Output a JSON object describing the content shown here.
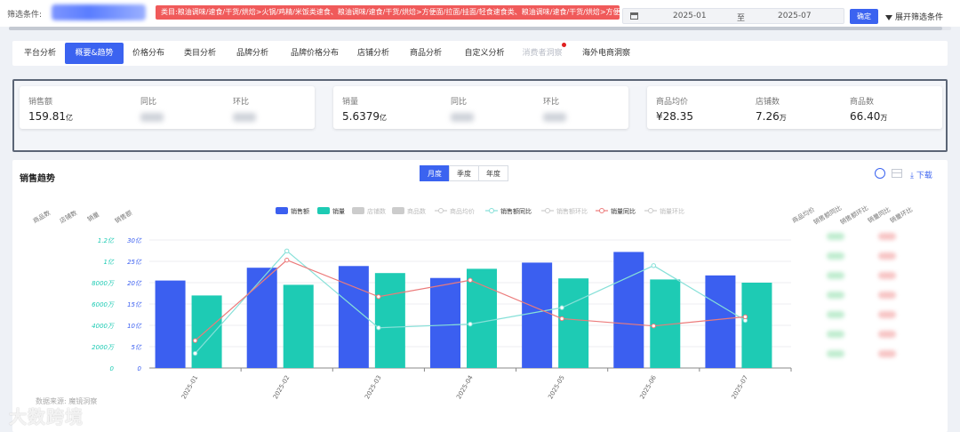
{
  "filter": {
    "label": "筛选条件:",
    "tags": "类目:粮油调味/速食/干货/烘焙>火锅/鸡精/米饭类速食、粮油调味/速食/干货/烘焙>方便面/拉面/挂面/轻食速食类、粮油调味/速食/干货/烘焙>方便粉丝/米线/粥汤类",
    "date_start": "2025-01",
    "date_sep": "至",
    "date_end": "2025-07",
    "confirm": "确定",
    "expand": "展开筛选条件"
  },
  "tabs": [
    {
      "label": "平台分析",
      "state": "normal"
    },
    {
      "label": "概要&趋势",
      "state": "active"
    },
    {
      "label": "价格分布",
      "state": "normal"
    },
    {
      "label": "类目分析",
      "state": "normal"
    },
    {
      "label": "品牌分析",
      "state": "normal"
    },
    {
      "label": "品牌价格分布",
      "state": "normal"
    },
    {
      "label": "店铺分析",
      "state": "normal"
    },
    {
      "label": "商品分析",
      "state": "normal"
    },
    {
      "label": "自定义分析",
      "state": "normal"
    },
    {
      "label": "消费者洞察",
      "state": "muted"
    },
    {
      "label": "海外电商洞察",
      "state": "normal"
    }
  ],
  "summary": {
    "sales": {
      "label": "销售额",
      "value": "159.81",
      "unit": "亿",
      "yoy": "同比",
      "mom": "环比"
    },
    "volume": {
      "label": "销量",
      "value": "5.6379",
      "unit": "亿",
      "yoy": "同比",
      "mom": "环比"
    },
    "avg_price": {
      "label": "商品均价",
      "value": "¥28.35"
    },
    "shops": {
      "label": "店铺数",
      "value": "7.26",
      "unit": "万"
    },
    "products": {
      "label": "商品数",
      "value": "66.40",
      "unit": "万"
    }
  },
  "panel": {
    "title": "销售趋势",
    "seg_month": "月度",
    "seg_quarter": "季度",
    "seg_year": "年度",
    "download": "下载",
    "source": "数据来源: 魔镜洞察"
  },
  "left_axis_titles": [
    "商品数",
    "店铺数",
    "销量",
    "销售额"
  ],
  "right_axis_titles": [
    "商品均价",
    "销售额同比",
    "销售额环比",
    "销量同比",
    "销量环比"
  ],
  "sales_ticks": [
    "0",
    "5亿",
    "10亿",
    "15亿",
    "20亿",
    "25亿",
    "30亿"
  ],
  "volume_ticks": [
    "0",
    "2000万",
    "4000万",
    "6000万",
    "8000万",
    "1亿",
    "1.2亿"
  ],
  "colors": {
    "sales": "#3b5ff0",
    "volume": "#1ecbb4",
    "sales_yoy": "#86e0d8",
    "volume_yoy": "#ec7b7b",
    "disabled": "#cccccc",
    "accent": "#3b63f0"
  },
  "chart_data": {
    "type": "bar",
    "categories": [
      "2025-01",
      "2025-02",
      "2025-03",
      "2025-04",
      "2025-05",
      "2025-06",
      "2025-07"
    ],
    "ylim": [
      0,
      30
    ],
    "y2lim": [
      0,
      120000000
    ],
    "legend": [
      {
        "name": "销售额",
        "kind": "bar",
        "enabled": true
      },
      {
        "name": "销量",
        "kind": "bar",
        "enabled": true
      },
      {
        "name": "店铺数",
        "kind": "bar",
        "enabled": false
      },
      {
        "name": "商品数",
        "kind": "bar",
        "enabled": false
      },
      {
        "name": "商品均价",
        "kind": "line",
        "enabled": false
      },
      {
        "name": "销售额同比",
        "kind": "line",
        "enabled": true
      },
      {
        "name": "销售额环比",
        "kind": "line",
        "enabled": false
      },
      {
        "name": "销量同比",
        "kind": "line",
        "enabled": true
      },
      {
        "name": "销量环比",
        "kind": "line",
        "enabled": false
      }
    ],
    "series": [
      {
        "name": "销售额",
        "axis": "sales",
        "unit": "亿",
        "values": [
          20.5,
          23.5,
          23.9,
          21.1,
          24.7,
          27.2,
          21.7
        ]
      },
      {
        "name": "销量",
        "axis": "volume",
        "unit": "件",
        "values": [
          68000000,
          78000000,
          89000000,
          93000000,
          84000000,
          83000000,
          80000000
        ]
      },
      {
        "name": "销售额同比",
        "axis": "hidden",
        "values": [
          -12,
          44,
          2,
          4,
          13,
          36,
          6
        ]
      },
      {
        "name": "销量同比",
        "axis": "hidden",
        "values": [
          -5,
          39,
          19,
          28,
          7,
          3,
          8
        ]
      }
    ]
  }
}
